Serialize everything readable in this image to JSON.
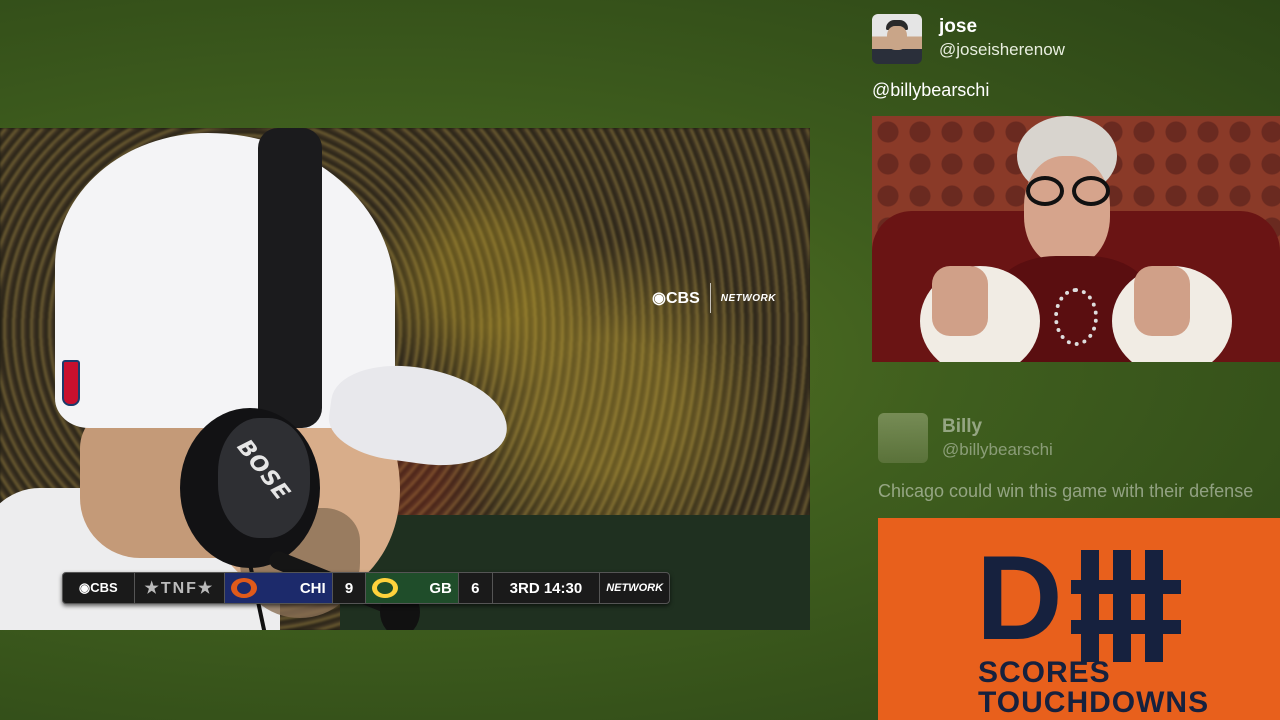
{
  "broadcast": {
    "network_bug": {
      "cbs": "◉CBS",
      "nfl_network": "NETWORK"
    },
    "headphone_brand": "BOSE",
    "scorebug": {
      "cbs": "◉CBS",
      "show": "★TNF★",
      "away_team": "CHI",
      "away_score": "9",
      "home_team": "GB",
      "home_score": "6",
      "clock": "3RD 14:30",
      "network": "NETWORK"
    }
  },
  "feed": {
    "tweets": [
      {
        "name": "jose",
        "handle": "@joseisherenow",
        "text": "@billybearschi",
        "media": "gif-thumbs-up"
      },
      {
        "name": "Billy",
        "handle": "@billybearschi",
        "text": "Chicago could win this game with their defense",
        "media": "d-fence-graphic"
      }
    ],
    "graphic": {
      "big_letter": "D",
      "line1": "SCORES",
      "line2": "TOUCHDOWNS"
    }
  },
  "colors": {
    "background": "#3f5e1e",
    "bears_orange": "#e8601c",
    "bears_navy": "#16213e"
  }
}
